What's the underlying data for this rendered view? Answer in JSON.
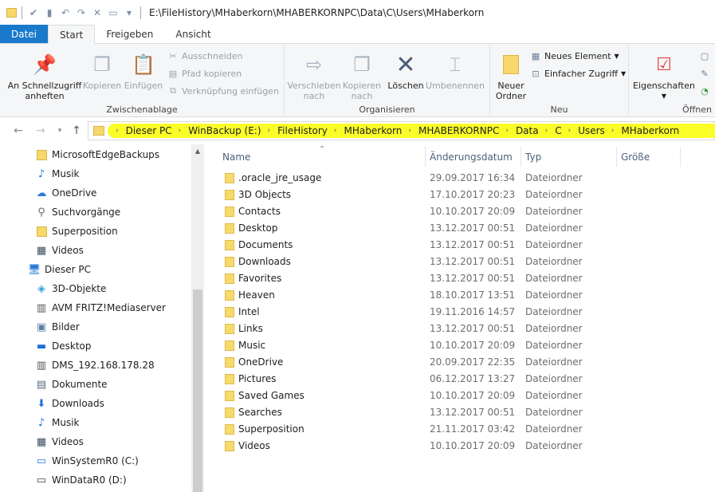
{
  "window": {
    "title": "E:\\FileHistory\\MHaberkorn\\MHABERKORNPC\\Data\\C\\Users\\MHaberkorn"
  },
  "tabs": [
    "Datei",
    "Start",
    "Freigeben",
    "Ansicht"
  ],
  "ribbon": {
    "pin": "An Schnellzugriff\nanheften",
    "copy": "Kopieren",
    "paste": "Einfügen",
    "cut": "Ausschneiden",
    "copy_path": "Pfad kopieren",
    "paste_shortcut": "Verknüpfung einfügen",
    "group_clipboard": "Zwischenablage",
    "move_to": "Verschieben\nnach",
    "copy_to": "Kopieren\nnach",
    "delete": "Löschen",
    "rename": "Umbenennen",
    "group_organize": "Organisieren",
    "new_folder": "Neuer\nOrdner",
    "new_item": "Neues Element",
    "easy_access": "Einfacher Zugriff",
    "group_new": "Neu",
    "properties": "Eigenschaften",
    "group_open": "Öffnen"
  },
  "breadcrumb": [
    "Dieser PC",
    "WinBackup (E:)",
    "FileHistory",
    "MHaberkorn",
    "MHABERKORNPC",
    "Data",
    "C",
    "Users",
    "MHaberkorn"
  ],
  "sidebar": [
    {
      "label": "MicrosoftEdgeBackups",
      "icon": "folder-icon"
    },
    {
      "label": "Musik",
      "icon": "music-icon"
    },
    {
      "label": "OneDrive",
      "icon": "onedrive-icon"
    },
    {
      "label": "Suchvorgänge",
      "icon": "search-icon"
    },
    {
      "label": "Superposition",
      "icon": "folder-icon"
    },
    {
      "label": "Videos",
      "icon": "video-icon"
    },
    {
      "label": "Dieser PC",
      "icon": "pc-icon"
    },
    {
      "label": "3D-Objekte",
      "icon": "cube-icon"
    },
    {
      "label": "AVM FRITZ!Mediaserver",
      "icon": "media-server-icon"
    },
    {
      "label": "Bilder",
      "icon": "pictures-icon"
    },
    {
      "label": "Desktop",
      "icon": "desktop-icon"
    },
    {
      "label": "DMS_192.168.178.28",
      "icon": "media-server-icon"
    },
    {
      "label": "Dokumente",
      "icon": "documents-icon"
    },
    {
      "label": "Downloads",
      "icon": "download-icon"
    },
    {
      "label": "Musik",
      "icon": "music-icon"
    },
    {
      "label": "Videos",
      "icon": "video-icon"
    },
    {
      "label": "WinSystemR0 (C:)",
      "icon": "drive-icon"
    },
    {
      "label": "WinDataR0 (D:)",
      "icon": "drive-icon"
    }
  ],
  "columns": {
    "name": "Name",
    "date": "Änderungsdatum",
    "type": "Typ",
    "size": "Größe"
  },
  "files": [
    {
      "name": ".oracle_jre_usage",
      "date": "29.09.2017 16:34",
      "type": "Dateiordner"
    },
    {
      "name": "3D Objects",
      "date": "17.10.2017 20:23",
      "type": "Dateiordner"
    },
    {
      "name": "Contacts",
      "date": "10.10.2017 20:09",
      "type": "Dateiordner"
    },
    {
      "name": "Desktop",
      "date": "13.12.2017 00:51",
      "type": "Dateiordner"
    },
    {
      "name": "Documents",
      "date": "13.12.2017 00:51",
      "type": "Dateiordner"
    },
    {
      "name": "Downloads",
      "date": "13.12.2017 00:51",
      "type": "Dateiordner"
    },
    {
      "name": "Favorites",
      "date": "13.12.2017 00:51",
      "type": "Dateiordner"
    },
    {
      "name": "Heaven",
      "date": "18.10.2017 13:51",
      "type": "Dateiordner"
    },
    {
      "name": "Intel",
      "date": "19.11.2016 14:57",
      "type": "Dateiordner"
    },
    {
      "name": "Links",
      "date": "13.12.2017 00:51",
      "type": "Dateiordner"
    },
    {
      "name": "Music",
      "date": "10.10.2017 20:09",
      "type": "Dateiordner"
    },
    {
      "name": "OneDrive",
      "date": "20.09.2017 22:35",
      "type": "Dateiordner"
    },
    {
      "name": "Pictures",
      "date": "06.12.2017 13:27",
      "type": "Dateiordner"
    },
    {
      "name": "Saved Games",
      "date": "10.10.2017 20:09",
      "type": "Dateiordner"
    },
    {
      "name": "Searches",
      "date": "13.12.2017 00:51",
      "type": "Dateiordner"
    },
    {
      "name": "Superposition",
      "date": "21.11.2017 03:42",
      "type": "Dateiordner"
    },
    {
      "name": "Videos",
      "date": "10.10.2017 20:09",
      "type": "Dateiordner"
    }
  ],
  "colors": {
    "file_tab": "#1979ca",
    "highlight": "#fbfd1d",
    "folder": "#f7d96c"
  }
}
